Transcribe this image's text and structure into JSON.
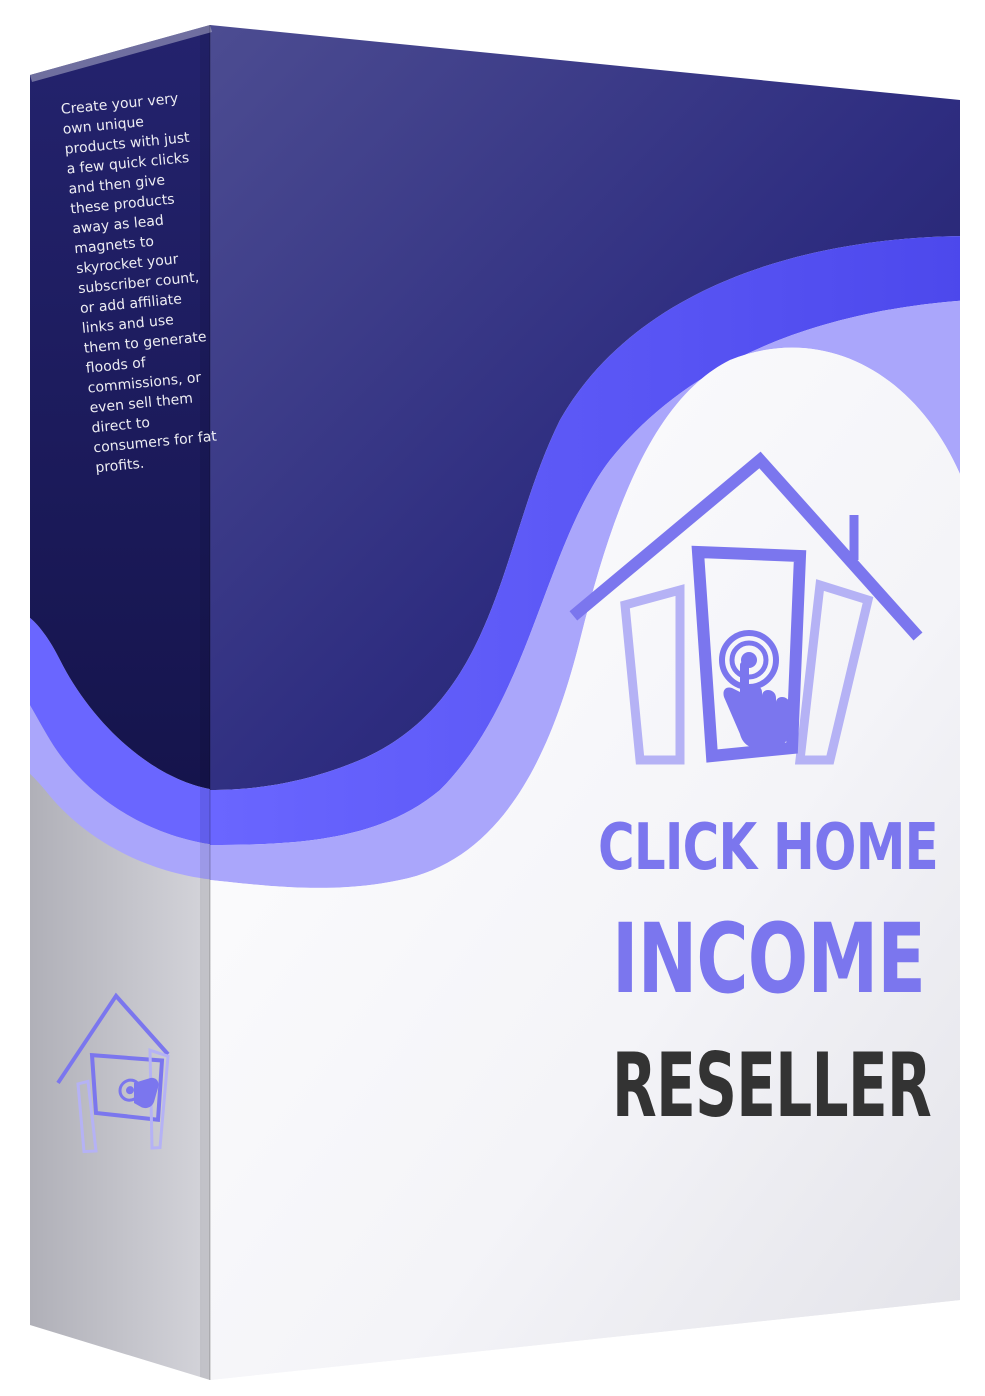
{
  "product": {
    "spine_blurb": "Create your very own unique products with just a few quick clicks and then give these products away as lead magnets to skyrocket your subscriber count, or add affiliate links and use them to generate floods of commissions, or even sell them direct to consumers for fat profits.",
    "title_line_1": "CLICK HOME",
    "title_line_2": "INCOME",
    "title_line_3": "RESELLER"
  },
  "colors": {
    "navy": "#2b2b7c",
    "wave_bright": "#5a56f2",
    "wave_light": "#aaa6fb",
    "logo_purple": "#7b76ee",
    "logo_light": "#b5b2f5",
    "reseller_text": "#333333",
    "spine_text": "#ffffff"
  },
  "icons": {
    "front_logo": "house-with-tap-hand-icon",
    "spine_logo": "house-with-tap-hand-icon"
  }
}
